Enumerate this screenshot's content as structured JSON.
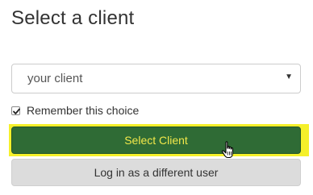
{
  "header": {
    "title": "Select a client"
  },
  "client_select": {
    "selected": "your client",
    "arrow_icon": "caret-down-icon"
  },
  "remember": {
    "label": "Remember this choice",
    "checked": true
  },
  "buttons": {
    "select_client": "Select Client",
    "different_user": "Log in as a different user"
  },
  "colors": {
    "primary_button": "#2f6b35",
    "primary_text": "#f2e84a",
    "highlight": "#f5f02a",
    "secondary_button": "#dcdcdc"
  }
}
